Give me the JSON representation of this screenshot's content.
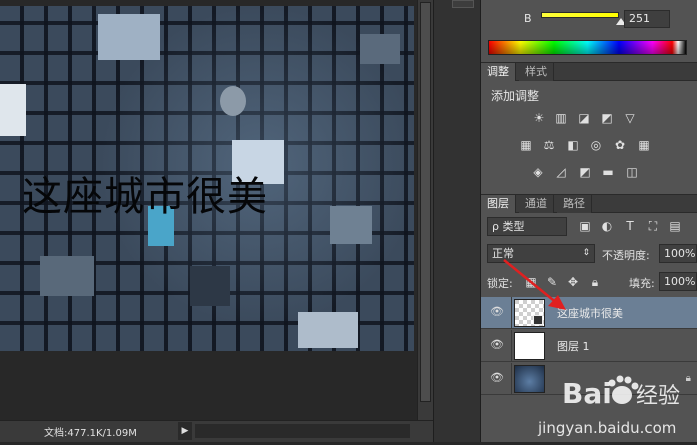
{
  "canvas": {
    "text": "这座城市很美"
  },
  "status": {
    "doc_info": "文档:477.1K/1.09M",
    "arrow": "▶"
  },
  "color_panel": {
    "channel_label": "B",
    "channel_value": "251",
    "slider_fraction": 0.98
  },
  "adjust_tabs": [
    {
      "label": "调整",
      "active": true
    },
    {
      "label": "样式",
      "active": false
    }
  ],
  "adjustments": {
    "title": "添加调整",
    "row1": [
      "☀",
      "▥",
      "◪",
      "◩",
      "▽"
    ],
    "row2": [
      "▦",
      "⚖",
      "◧",
      "◎",
      "✿",
      "▦"
    ],
    "row3": [
      "◈",
      "◿",
      "◩",
      "▬",
      "◫"
    ]
  },
  "layer_tabs": [
    {
      "label": "图层",
      "active": true
    },
    {
      "label": "通道",
      "active": false
    },
    {
      "label": "路径",
      "active": false
    }
  ],
  "layers_panel": {
    "filter_label": "ρ 类型",
    "filter_icons": [
      "▣",
      "◐",
      "T",
      "⛶",
      "▤"
    ],
    "blend_mode": "正常",
    "opacity_label": "不透明度:",
    "opacity_value": "100%",
    "lock_label": "锁定:",
    "fill_label": "填充:",
    "fill_value": "100%"
  },
  "layers": [
    {
      "name": "这座城市很美",
      "selected": true,
      "visible": true
    },
    {
      "name": "图层 1",
      "selected": false,
      "visible": true
    },
    {
      "name": "",
      "selected": false,
      "visible": true
    }
  ],
  "watermark": {
    "brand": "Bai",
    "brand_cn": "经验",
    "url": "jingyan.baidu.com"
  },
  "colors": {
    "accent_arrow": "#e02020",
    "selected_layer": "#6b7f95"
  }
}
